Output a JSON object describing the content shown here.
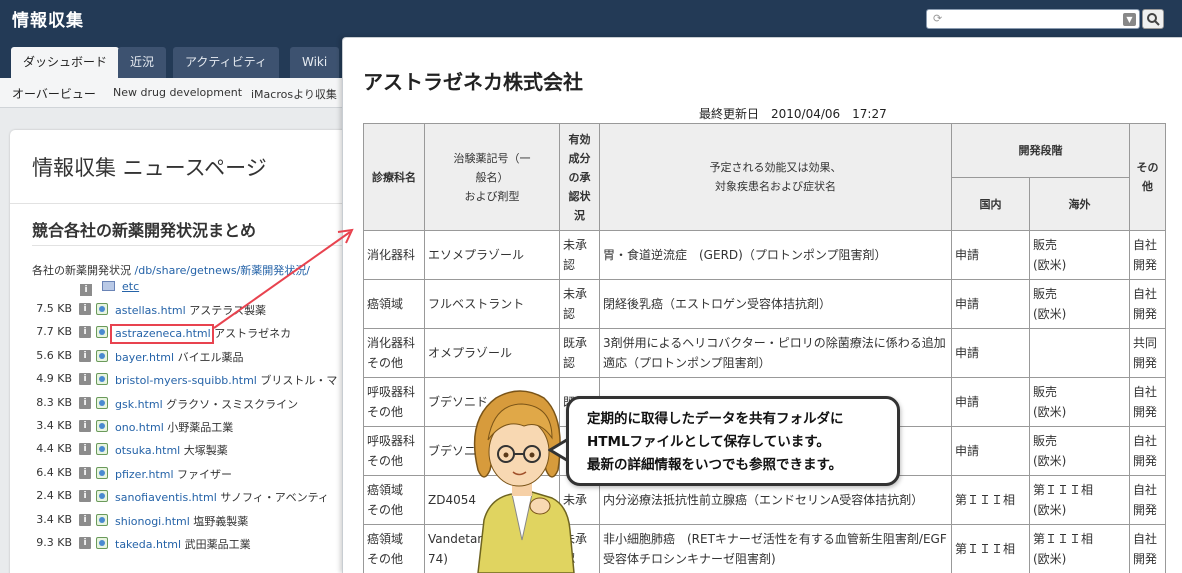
{
  "app": {
    "title": "情報収集"
  },
  "nav": {
    "tabs": [
      {
        "label": "ダッシュボード",
        "active": true
      },
      {
        "label": "近況",
        "active": false
      },
      {
        "label": "アクティビティ",
        "active": false
      },
      {
        "label": "Wiki",
        "active": false
      }
    ],
    "subnav": [
      "オーバービュー",
      "New drug development",
      "iMacrosより収集"
    ]
  },
  "leftpage": {
    "title": "情報収集 ニュースページ",
    "section": "競合各社の新薬開発状況まとめ",
    "path_label": "各社の新薬開発状況",
    "path_link": "/db/share/getnews/新薬開発状況/",
    "folder": "etc",
    "info_glyph": "i",
    "files": [
      {
        "size": "7.5 KB",
        "file": "astellas.html",
        "company": "アステラス製薬"
      },
      {
        "size": "7.7 KB",
        "file": "astrazeneca.html",
        "company": "アストラゼネカ"
      },
      {
        "size": "5.6 KB",
        "file": "bayer.html",
        "company": "バイエル薬品"
      },
      {
        "size": "4.9 KB",
        "file": "bristol-myers-squibb.html",
        "company": "ブリストル・マ"
      },
      {
        "size": "8.3 KB",
        "file": "gsk.html",
        "company": "グラクソ・スミスクライン"
      },
      {
        "size": "3.4 KB",
        "file": "ono.html",
        "company": "小野薬品工業"
      },
      {
        "size": "4.4 KB",
        "file": "otsuka.html",
        "company": "大塚製薬"
      },
      {
        "size": "6.4 KB",
        "file": "pfizer.html",
        "company": "ファイザー"
      },
      {
        "size": "2.4 KB",
        "file": "sanofiaventis.html",
        "company": "サノフィ・アベンティ"
      },
      {
        "size": "3.4 KB",
        "file": "shionogi.html",
        "company": "塩野義製薬"
      },
      {
        "size": "9.3 KB",
        "file": "takeda.html",
        "company": "武田薬品工業"
      }
    ]
  },
  "document": {
    "company": "アストラゼネカ株式会社",
    "updated": "最終更新日　2010/04/06　17:27",
    "headers": {
      "dept": "診療科名",
      "code_line1": "治験薬記号（一般名）",
      "code_line2": "および剤型",
      "approval": "有効成分の承認状況",
      "effect_line1": "予定される効能又は効果、",
      "effect_line2": "対象疾患名および症状名",
      "stage": "開発段階",
      "domestic": "国内",
      "overseas": "海外",
      "other": "その他"
    },
    "rows": [
      {
        "dept": "消化器科",
        "drug": "エソメプラゾール",
        "approval": "未承認",
        "effect": "胃・食道逆流症　(GERD)（プロトンポンプ阻害剤）",
        "domestic": "申請",
        "overseas": "販売\n(欧米)",
        "other": "自社開発"
      },
      {
        "dept": "癌領域",
        "drug": "フルベストラント",
        "approval": "未承認",
        "effect": "閉経後乳癌（エストロゲン受容体拮抗剤）",
        "domestic": "申請",
        "overseas": "販売\n(欧米)",
        "other": "自社開発"
      },
      {
        "dept": "消化器科\nその他",
        "drug": "オメプラゾール",
        "approval": "既承認",
        "effect": "3剤併用によるヘリコバクター・ピロリの除菌療法に係わる追加適応（プロトンポンプ阻害剤）",
        "domestic": "申請",
        "overseas": "",
        "other": "共同開発"
      },
      {
        "dept": "呼吸器科\nその他",
        "drug": "ブデソニド",
        "approval": "既承",
        "effect": "",
        "domestic": "申請",
        "overseas": "販売\n(欧米)",
        "other": "自社開発"
      },
      {
        "dept": "呼吸器科\nその他",
        "drug": "ブデソニ",
        "approval": "",
        "effect": "",
        "domestic": "申請",
        "overseas": "販売\n(欧米)",
        "other": "自社開発"
      },
      {
        "dept": "癌領域\nその他",
        "drug": "ZD4054",
        "approval": "未承",
        "effect": "内分泌療法抵抗性前立腺癌（エンドセリンA受容体拮抗剤）",
        "domestic": "第ＩＩＩ相",
        "overseas": "第ＩＩＩ相\n(欧米)",
        "other": "自社開発"
      },
      {
        "dept": "癌領域\nその他",
        "drug": "Vandetanib　　　　74)",
        "approval": "未承認",
        "effect": "非小細胞肺癌　(RETキナーゼ活性を有する血管新生阻害剤/EGF受容体チロシンキナーゼ阻害剤)",
        "domestic": "第ＩＩＩ相",
        "overseas": "第ＩＩＩ相\n(欧米)",
        "other": "自社開発"
      }
    ]
  },
  "bubble": {
    "line1": "定期的に取得したデータを共有フォルダに",
    "line2": "HTMLファイルとして保存しています。",
    "line3": "最新の詳細情報をいつでも参照できます。"
  },
  "colors": {
    "header": "#233a56",
    "link": "#2563a8",
    "highlight": "#e8434f"
  }
}
